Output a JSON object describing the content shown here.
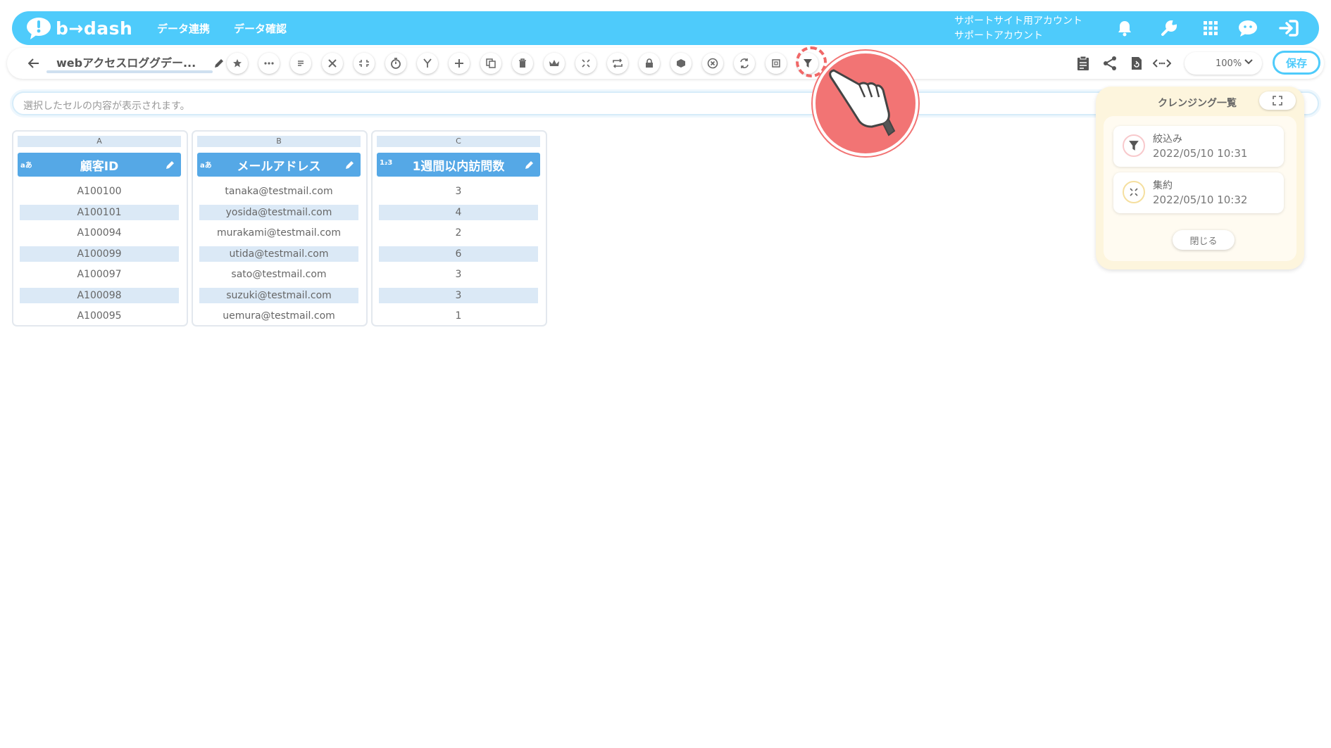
{
  "header": {
    "logo_text": "b→dash",
    "nav": [
      "データ連携",
      "データ確認"
    ],
    "account_line1": "サポートサイト用アカウント",
    "account_line2": "サポートアカウント",
    "brand_color": "#4ecbfb"
  },
  "toolbar": {
    "title": "webアクセスロググデー...",
    "zoom": "100%",
    "save_label": "保存",
    "tools": [
      "star",
      "more",
      "note",
      "cut",
      "collapse",
      "timer",
      "merge",
      "add",
      "copy",
      "delete",
      "crown",
      "aggregate",
      "repeat",
      "lock",
      "layer",
      "cancel",
      "replace",
      "frame",
      "filter"
    ]
  },
  "formula_bar": {
    "placeholder": "選択したセルの内容が表示されます。"
  },
  "grid": {
    "columns": [
      {
        "letter": "A",
        "type": "aあ",
        "name": "顧客ID",
        "cells": [
          "A100100",
          "A100101",
          "A100094",
          "A100099",
          "A100097",
          "A100098",
          "A100095"
        ]
      },
      {
        "letter": "B",
        "type": "aあ",
        "name": "メールアドレス",
        "cells": [
          "tanaka@testmail.com",
          "yosida@testmail.com",
          "murakami@testmail.com",
          "utida@testmail.com",
          "sato@testmail.com",
          "suzuki@testmail.com",
          "uemura@testmail.com"
        ]
      },
      {
        "letter": "C",
        "type": "1₂3",
        "name": "1週間以内訪問数",
        "cells": [
          "3",
          "4",
          "2",
          "6",
          "3",
          "3",
          "1"
        ]
      }
    ]
  },
  "cleansing_panel": {
    "title": "クレンジング一覧",
    "items": [
      {
        "name": "絞込み",
        "date": "2022/05/10 10:31",
        "icon": "filter-icon"
      },
      {
        "name": "集約",
        "date": "2022/05/10 10:32",
        "icon": "aggregate-icon"
      }
    ],
    "close_label": "閉じる"
  }
}
